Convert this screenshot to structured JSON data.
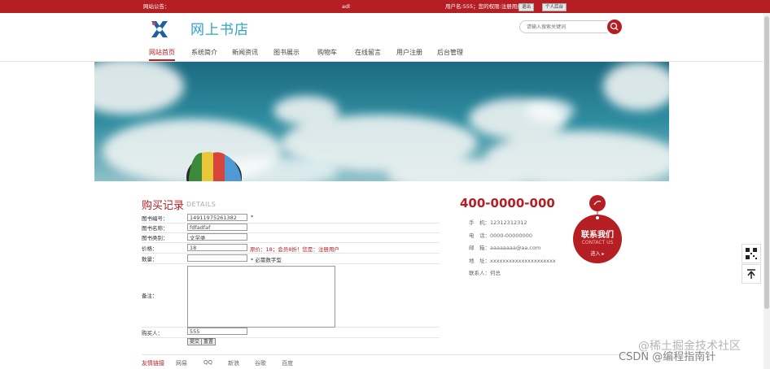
{
  "topbar": {
    "notice_label": "网站公告：",
    "greeting": "adl",
    "user_status": "用户名:555；您的权限:注册用户",
    "logout_label": "退出",
    "profile_label": "个人后台"
  },
  "header": {
    "site_title": "网上书店",
    "search_placeholder": "请输入搜索关键词"
  },
  "nav": {
    "items": [
      {
        "label": "网站首页",
        "active": true
      },
      {
        "label": "系统简介"
      },
      {
        "label": "新闻资讯"
      },
      {
        "label": "图书展示"
      },
      {
        "label": "购物车"
      },
      {
        "label": "在线留言"
      },
      {
        "label": "用户注册"
      },
      {
        "label": "后台管理"
      }
    ]
  },
  "form": {
    "title": "购买记录",
    "subtitle": "DETAILS",
    "book_no_label": "图书编号：",
    "book_no_value": "14911975261382",
    "book_no_star": "*",
    "book_name_label": "图书名称：",
    "book_name_value": "fdfadfaf",
    "book_type_label": "图书类别：",
    "book_type_value": "文学类",
    "price_label": "价格：",
    "price_value": "18",
    "price_hint": "原价：18；会员8折！您是：注册用户",
    "qty_label": "数量：",
    "qty_value": "",
    "qty_hint": "* 必需数字型",
    "note_label": "备注：",
    "note_value": "",
    "buyer_label": "购买人：",
    "buyer_value": "555",
    "submit_label": "提交",
    "reset_label": "重置"
  },
  "contact": {
    "hotline": "400-0000-000",
    "mobile": "手　机：12312312312",
    "tel": "电　话：0000-00000000",
    "email": "邮　箱：aaaaaaaa@aa.com",
    "address": "地　址：xxxxxxxxxxxxxxxxxxxxx",
    "person": "联系人：何总",
    "tag_title": "联系我们",
    "tag_sub": "CONTACT US",
    "tag_more": "进入 ▸"
  },
  "footer": {
    "links": [
      "友情链接",
      "网易",
      "QQ",
      "新浪",
      "谷歌",
      "百度"
    ]
  },
  "watermark": {
    "line1": "@稀土掘金技术社区",
    "line2": "CSDN @编程指南针"
  },
  "colors": {
    "brand_red": "#b51f24",
    "title_blue": "#2fa3c9"
  }
}
